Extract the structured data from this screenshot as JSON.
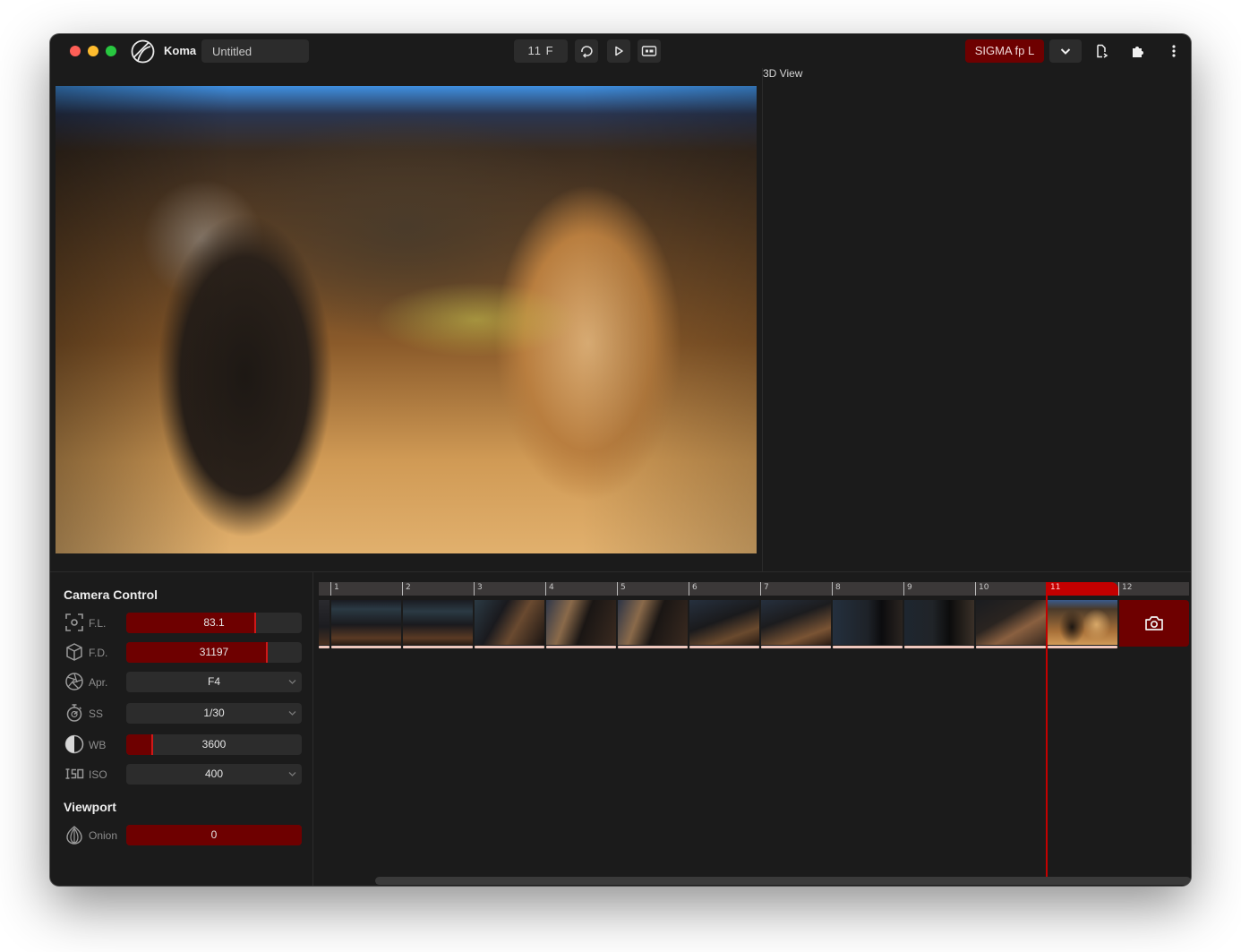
{
  "titlebar": {
    "app_name": "Koma",
    "project_name": "Untitled",
    "frame_count": "11 F",
    "camera_name": "SIGMA fp L"
  },
  "viewport": {
    "panel_3d_label": "3D View"
  },
  "camera_control": {
    "title": "Camera Control",
    "params": [
      {
        "icon": "focus-frame-icon",
        "label": "F.L.",
        "value": "83.1",
        "control": "slider",
        "level_fraction": 0.73
      },
      {
        "icon": "focus-cube-icon",
        "label": "F.D.",
        "value": "31197",
        "control": "slider",
        "level_fraction": 0.8
      },
      {
        "icon": "aperture-icon",
        "label": "Apr.",
        "value": "F4",
        "control": "dropdown"
      },
      {
        "icon": "stopwatch-icon",
        "label": "SS",
        "value": "1/30",
        "control": "dropdown"
      },
      {
        "icon": "white-balance-icon",
        "label": "WB",
        "value": "3600",
        "control": "slider",
        "level_fraction": 0.15
      },
      {
        "icon": "iso-icon",
        "label": "ISO",
        "value": "400",
        "control": "dropdown"
      }
    ]
  },
  "viewport_settings": {
    "title": "Viewport",
    "onion": {
      "icon": "onion-icon",
      "label": "Onion",
      "value": "0"
    }
  },
  "timeline": {
    "ticks": [
      "",
      "1",
      "2",
      "3",
      "4",
      "5",
      "6",
      "7",
      "8",
      "9",
      "10",
      "11",
      "12"
    ],
    "current_frame": "11",
    "thumbnails": [
      {
        "frame": "0",
        "tone": "dark-monitor"
      },
      {
        "frame": "1",
        "tone": "dark-monitor"
      },
      {
        "frame": "2",
        "tone": "dark-monitor"
      },
      {
        "frame": "3",
        "tone": "cable-warm"
      },
      {
        "frame": "4",
        "tone": "cable-warm"
      },
      {
        "frame": "5",
        "tone": "cable-warm"
      },
      {
        "frame": "6",
        "tone": "cable-warm"
      },
      {
        "frame": "7",
        "tone": "cable-warm"
      },
      {
        "frame": "8",
        "tone": "dark-object"
      },
      {
        "frame": "9",
        "tone": "dark-object"
      },
      {
        "frame": "10",
        "tone": "cable-warm"
      },
      {
        "frame": "11",
        "tone": "figurine"
      }
    ]
  },
  "colors": {
    "accent_dark_red": "#6e0000",
    "accent_red": "#c40000",
    "background": "#1b1b1b",
    "control_bg": "#2c2c2c"
  }
}
